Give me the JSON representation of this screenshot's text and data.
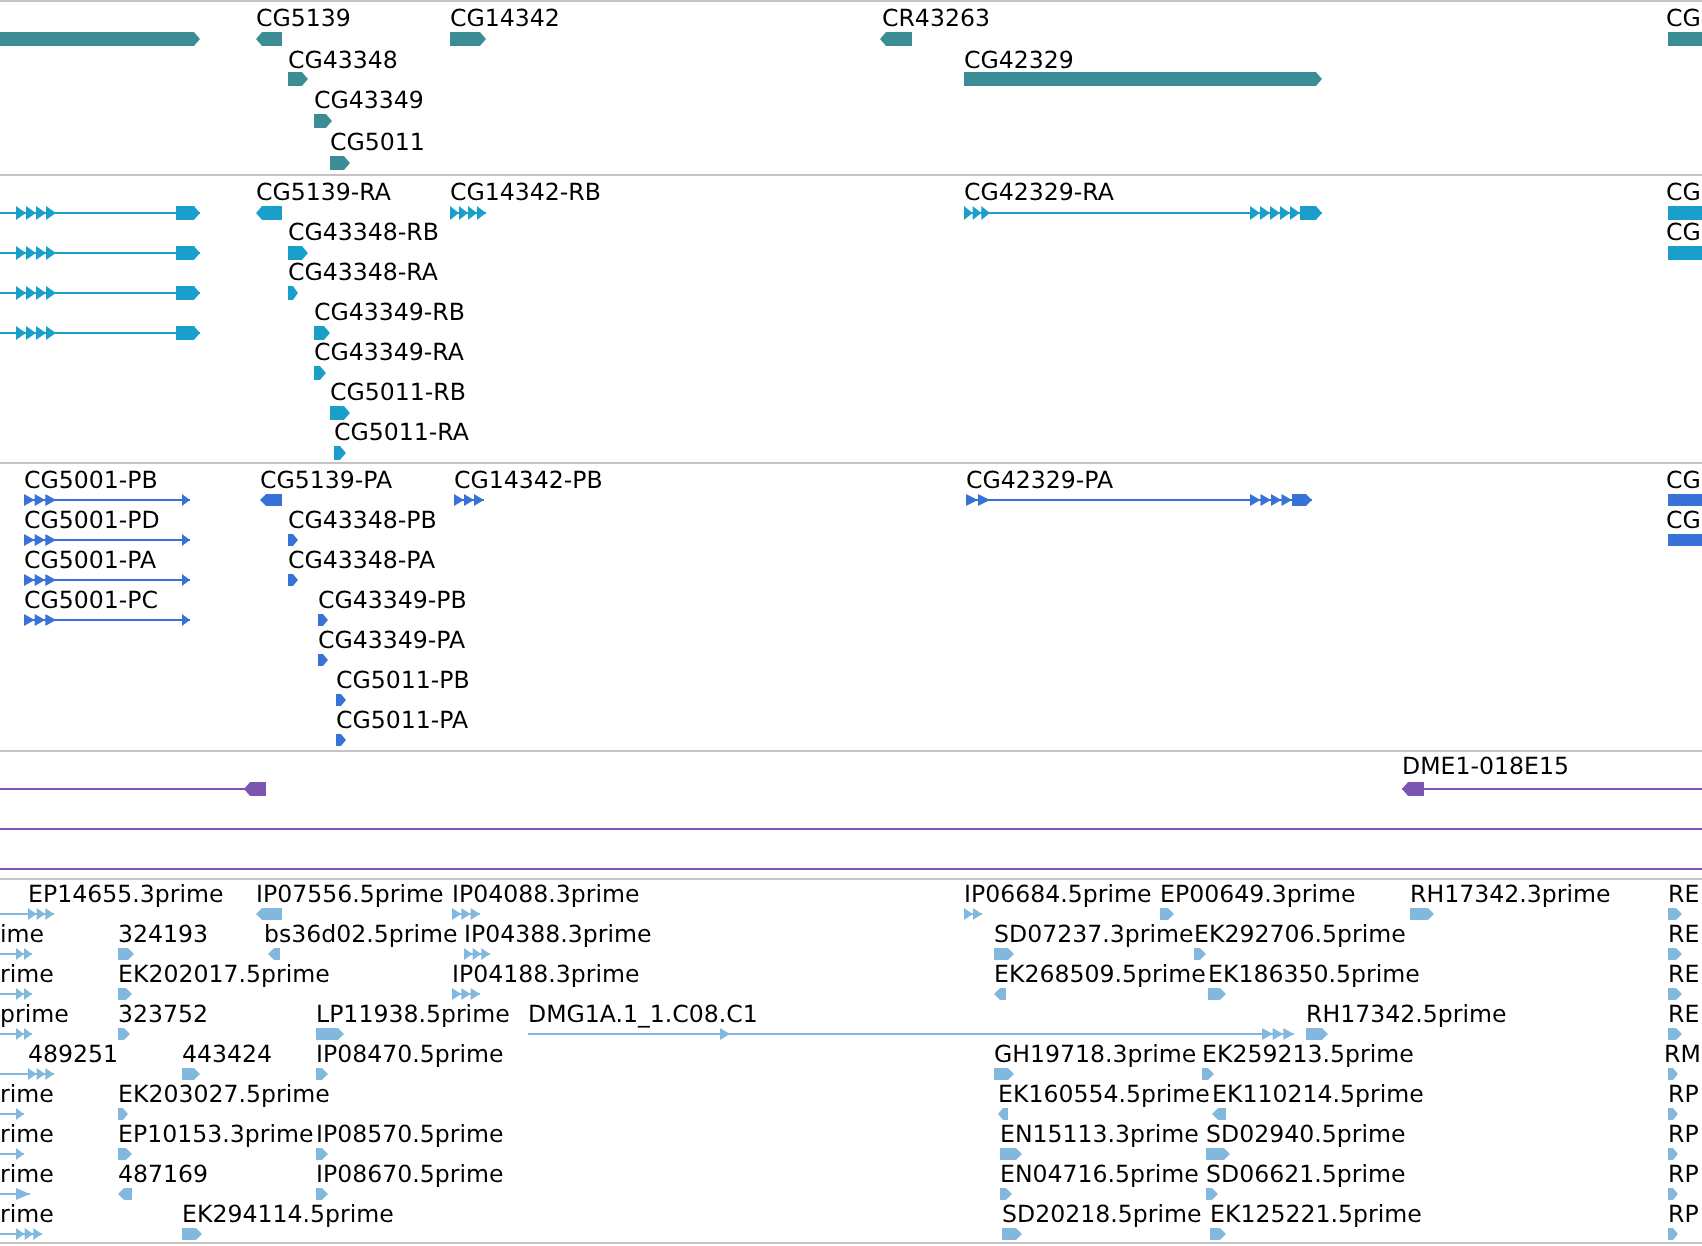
{
  "tracks": [
    {
      "kind": "gene",
      "features": [
        {
          "kind": "block",
          "reverse": false
        },
        {
          "label": "CG5139",
          "kind": "block",
          "reverse": true
        },
        {
          "label": "CG14342",
          "kind": "block",
          "reverse": false
        },
        {
          "label": "CR43263",
          "kind": "block",
          "reverse": true
        },
        {
          "label": "CG",
          "kind": "block"
        },
        {
          "label": "CG43348",
          "kind": "block",
          "reverse": false
        },
        {
          "label": "CG42329",
          "kind": "block",
          "reverse": false
        },
        {
          "label": "CG43349",
          "kind": "block",
          "reverse": false
        },
        {
          "label": "CG5011",
          "kind": "block",
          "reverse": false
        }
      ]
    },
    {
      "kind": "transcript",
      "features": [
        {
          "kind": "spliced",
          "reverse": false
        },
        {
          "label": "CG5139-RA",
          "kind": "block",
          "reverse": true
        },
        {
          "label": "CG14342-RB",
          "kind": "spliced",
          "reverse": false
        },
        {
          "label": "CG42329-RA",
          "kind": "spliced",
          "reverse": false
        },
        {
          "label": "CG",
          "kind": "block"
        },
        {
          "kind": "spliced",
          "reverse": false
        },
        {
          "label": "CG43348-RB",
          "kind": "block",
          "reverse": false
        },
        {
          "label": "CG",
          "kind": "block"
        },
        {
          "kind": "spliced",
          "reverse": false
        },
        {
          "label": "CG43348-RA",
          "kind": "block",
          "reverse": false
        },
        {
          "kind": "spliced",
          "reverse": false
        },
        {
          "label": "CG43349-RB",
          "kind": "block",
          "reverse": false
        },
        {
          "label": "CG43349-RA",
          "kind": "block",
          "reverse": false
        },
        {
          "label": "CG5011-RB",
          "kind": "block",
          "reverse": false
        },
        {
          "label": "CG5011-RA",
          "kind": "block",
          "reverse": false
        }
      ]
    },
    {
      "kind": "protein",
      "features": [
        {
          "label": "CG5001-PB",
          "kind": "spliced",
          "reverse": false
        },
        {
          "label": "CG5139-PA",
          "kind": "block",
          "reverse": true
        },
        {
          "label": "CG14342-PB",
          "kind": "spliced",
          "reverse": false
        },
        {
          "label": "CG42329-PA",
          "kind": "spliced",
          "reverse": false
        },
        {
          "label": "CG",
          "kind": "block"
        },
        {
          "label": "CG5001-PD",
          "kind": "spliced",
          "reverse": false
        },
        {
          "label": "CG43348-PB",
          "kind": "block",
          "reverse": false
        },
        {
          "label": "CG",
          "kind": "block"
        },
        {
          "label": "CG5001-PA",
          "kind": "spliced",
          "reverse": false
        },
        {
          "label": "CG43348-PA",
          "kind": "block",
          "reverse": false
        },
        {
          "label": "CG5001-PC",
          "kind": "spliced",
          "reverse": false
        },
        {
          "label": "CG43349-PB",
          "kind": "block",
          "reverse": false
        },
        {
          "label": "CG43349-PA",
          "kind": "block",
          "reverse": false
        },
        {
          "label": "CG5011-PB",
          "kind": "block",
          "reverse": false
        },
        {
          "label": "CG5011-PA",
          "kind": "block",
          "reverse": false
        }
      ]
    },
    {
      "kind": "clone",
      "features": [
        {
          "kind": "spliced",
          "reverse": true
        },
        {
          "label": "DME1-018E15",
          "kind": "spliced",
          "reverse": true
        },
        {
          "kind": "span"
        },
        {
          "kind": "span"
        }
      ]
    },
    {
      "kind": "est",
      "features": [
        {
          "label": "EP14655.3prime",
          "kind": "spliced",
          "reverse": false
        },
        {
          "label": "IP07556.5prime",
          "kind": "block",
          "reverse": true
        },
        {
          "label": "IP04088.3prime",
          "kind": "spliced",
          "reverse": false
        },
        {
          "label": "IP06684.5prime",
          "kind": "spliced",
          "reverse": false
        },
        {
          "label": "EP00649.3prime",
          "kind": "block",
          "reverse": false
        },
        {
          "label": "RH17342.3prime",
          "kind": "block",
          "reverse": false
        },
        {
          "label": "RE",
          "kind": "block",
          "reverse": false
        },
        {
          "label": "ime",
          "kind": "spliced",
          "reverse": false
        },
        {
          "label": "324193",
          "kind": "block",
          "reverse": false
        },
        {
          "label": "bs36d02.5prime",
          "kind": "block",
          "reverse": true
        },
        {
          "label": "IP04388.3prime",
          "kind": "spliced",
          "reverse": false
        },
        {
          "label": "SD07237.3prime",
          "kind": "block",
          "reverse": false
        },
        {
          "label": "EK292706.5prime",
          "kind": "block",
          "reverse": false
        },
        {
          "label": "RE",
          "kind": "block",
          "reverse": false
        },
        {
          "label": "rime",
          "kind": "spliced",
          "reverse": false
        },
        {
          "label": "EK202017.5prime",
          "kind": "block",
          "reverse": false
        },
        {
          "label": "IP04188.3prime",
          "kind": "spliced",
          "reverse": false
        },
        {
          "label": "EK268509.5prime",
          "kind": "block",
          "reverse": true
        },
        {
          "label": "EK186350.5prime",
          "kind": "block",
          "reverse": false
        },
        {
          "label": "RE",
          "kind": "block",
          "reverse": false
        },
        {
          "label": "prime",
          "kind": "spliced",
          "reverse": false
        },
        {
          "label": "323752",
          "kind": "block",
          "reverse": false
        },
        {
          "label": "LP11938.5prime",
          "kind": "block",
          "reverse": false
        },
        {
          "label": "DMG1A.1_1.C08.C1",
          "kind": "spliced",
          "reverse": false
        },
        {
          "label": "RH17342.5prime",
          "kind": "block",
          "reverse": false
        },
        {
          "label": "RE",
          "kind": "block",
          "reverse": false
        },
        {
          "label": "489251",
          "kind": "spliced",
          "reverse": false
        },
        {
          "label": "443424",
          "kind": "block",
          "reverse": false
        },
        {
          "label": "IP08470.5prime",
          "kind": "block",
          "reverse": false
        },
        {
          "label": "GH19718.3prime",
          "kind": "block",
          "reverse": false
        },
        {
          "label": "EK259213.5prime",
          "kind": "block",
          "reverse": false
        },
        {
          "label": "RM",
          "kind": "block",
          "reverse": false
        },
        {
          "label": "rime",
          "kind": "spliced",
          "reverse": false
        },
        {
          "label": "EK203027.5prime",
          "kind": "block",
          "reverse": false
        },
        {
          "label": "EK160554.5prime",
          "kind": "block",
          "reverse": true
        },
        {
          "label": "EK110214.5prime",
          "kind": "block",
          "reverse": true
        },
        {
          "label": "RP",
          "kind": "block",
          "reverse": false
        },
        {
          "label": "rime",
          "kind": "spliced",
          "reverse": false
        },
        {
          "label": "EP10153.3prime",
          "kind": "block",
          "reverse": false
        },
        {
          "label": "IP08570.5prime",
          "kind": "block",
          "reverse": false
        },
        {
          "label": "EN15113.3prime",
          "kind": "block",
          "reverse": false
        },
        {
          "label": "SD02940.5prime",
          "kind": "block",
          "reverse": false
        },
        {
          "label": "RP",
          "kind": "block",
          "reverse": false
        },
        {
          "label": "rime",
          "kind": "spliced",
          "reverse": false
        },
        {
          "label": "487169",
          "kind": "block",
          "reverse": true
        },
        {
          "label": "IP08670.5prime",
          "kind": "block",
          "reverse": false
        },
        {
          "label": "EN04716.5prime",
          "kind": "block",
          "reverse": false
        },
        {
          "label": "SD06621.5prime",
          "kind": "block",
          "reverse": false
        },
        {
          "label": "RP",
          "kind": "block",
          "reverse": false
        },
        {
          "label": "rime",
          "kind": "spliced",
          "reverse": false
        },
        {
          "label": "EK294114.5prime",
          "kind": "block",
          "reverse": false
        },
        {
          "label": "SD20218.5prime",
          "kind": "block",
          "reverse": false
        },
        {
          "label": "EK125221.5prime",
          "kind": "block",
          "reverse": false
        },
        {
          "label": "RP",
          "kind": "block",
          "reverse": false
        }
      ]
    }
  ]
}
